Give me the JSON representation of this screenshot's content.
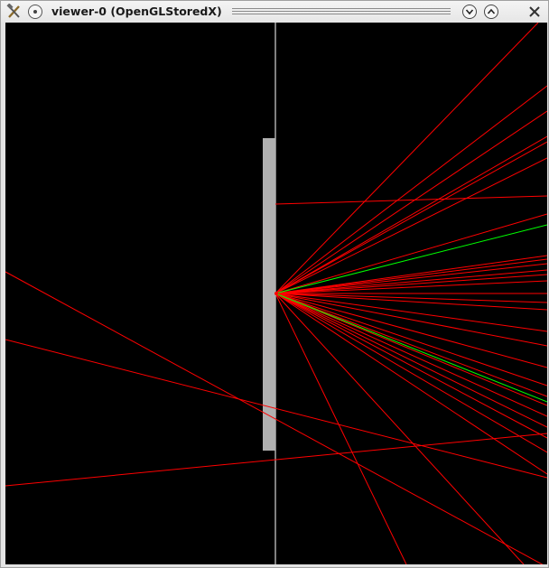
{
  "window": {
    "title": "viewer-0 (OpenGLStoredX)",
    "icons": {
      "app": "tools-icon",
      "menu": "window-menu-icon",
      "minimize": "chevron-down-icon",
      "maximize": "chevron-up-icon",
      "close": "close-icon"
    }
  },
  "scene": {
    "background_color": "#000000",
    "axis_color": "#ffffff",
    "target_color": "#b0b0b0",
    "track_color": "#ff0000",
    "neutral_track_color": "#00ff00"
  }
}
